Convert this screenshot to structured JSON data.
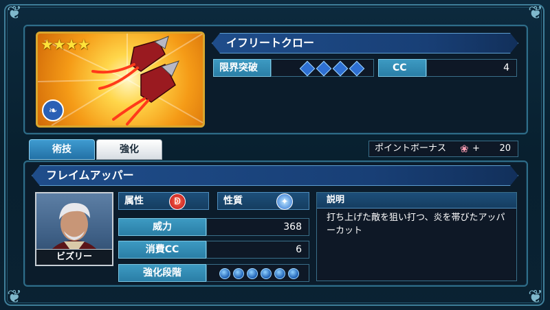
{
  "item": {
    "stars": "★★★★",
    "name": "イフリートクロー",
    "limit_break_label": "限界突破",
    "limit_break_gems": 4,
    "cc_label": "CC",
    "cc_value": "4"
  },
  "tabs": [
    {
      "label": "術技",
      "active": true
    },
    {
      "label": "強化",
      "active": false
    }
  ],
  "point_bonus": {
    "label": "ポイントボーナス",
    "icon": "flower-icon",
    "plus": "+",
    "value": "20"
  },
  "skill": {
    "name": "フレイムアッパー",
    "attribute_label": "属性",
    "attribute_icon": "fire-icon",
    "nature_label": "性質",
    "nature_icon": "crystal-icon",
    "power_label": "威力",
    "power_value": "368",
    "cost_label": "消費CC",
    "cost_value": "6",
    "enhance_label": "強化段階",
    "enhance_orbs": 6,
    "description_label": "説明",
    "description": "打ち上げた敵を狙い打つ、炎を帯びたアッパーカット"
  },
  "character": {
    "name": "ビズリー"
  },
  "colors": {
    "accent": "#2a7ea6",
    "gold": "#d9a72e",
    "banner": "#1f4d8a",
    "fire": "#d0202a"
  }
}
